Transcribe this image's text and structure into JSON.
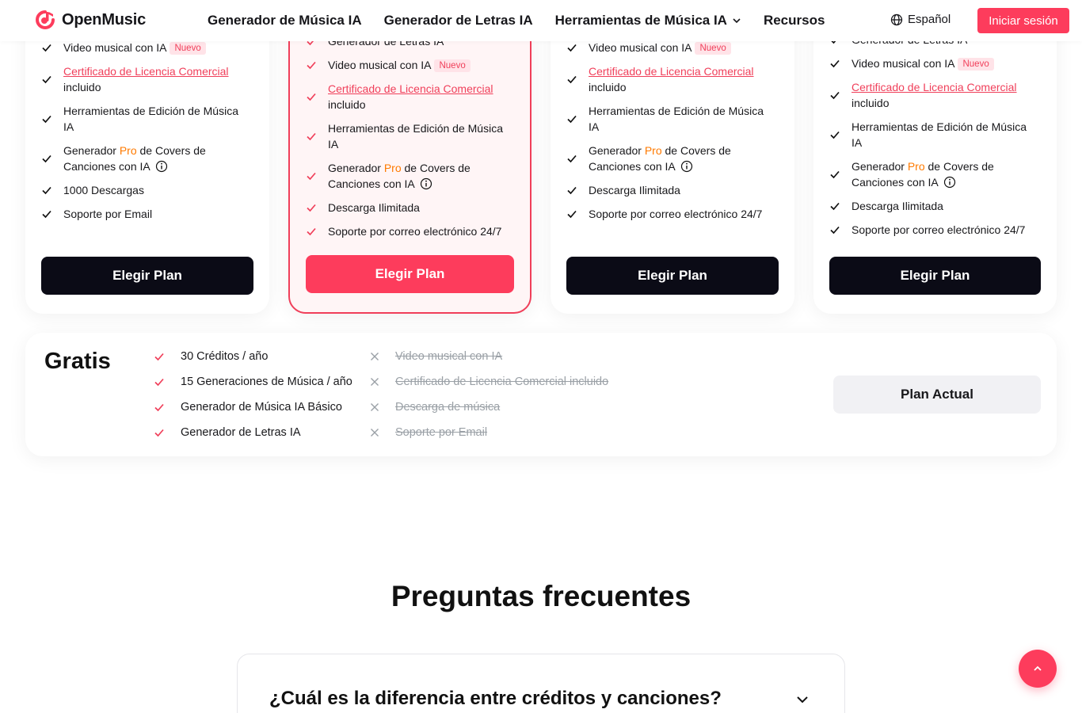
{
  "brand": {
    "name": "OpenMusic",
    "accent": "#fd3c5c",
    "dark": "#0b0b16",
    "pro_color": "#ff7a00"
  },
  "nav": {
    "items": [
      "Generador de Música IA",
      "Generador de Letras IA",
      "Herramientas de Música IA",
      "Recursos"
    ],
    "language": "Español",
    "login": "Iniciar sesión"
  },
  "plans": [
    {
      "features": {
        "video": "Video musical con IA",
        "license_link": "Certificado de Licencia Comercial",
        "license_suffix": "incluido",
        "editing": "Herramientas de Edición de Música IA",
        "covers_pre": "Generador",
        "covers_pro": "Pro",
        "covers_post": "de Covers de Canciones con IA",
        "downloads": "1000 Descargas",
        "support": "Soporte por Email"
      },
      "badge": "Nuevo",
      "button": "Elegir Plan"
    },
    {
      "features": {
        "lyrics": "Generador de Letras IA",
        "video": "Video musical con IA",
        "license_link": "Certificado de Licencia Comercial",
        "license_suffix": "incluido",
        "editing": "Herramientas de Edición de Música IA",
        "covers_pre": "Generador",
        "covers_pro": "Pro",
        "covers_post": "de Covers de Canciones con IA",
        "downloads": "Descarga Ilimitada",
        "support": "Soporte por correo electrónico 24/7"
      },
      "badge": "Nuevo",
      "button": "Elegir Plan"
    },
    {
      "features": {
        "video": "Video musical con IA",
        "license_link": "Certificado de Licencia Comercial",
        "license_suffix": "incluido",
        "editing": "Herramientas de Edición de Música IA",
        "covers_pre": "Generador",
        "covers_pro": "Pro",
        "covers_post": "de Covers de Canciones con IA",
        "downloads": "Descarga Ilimitada",
        "support": "Soporte por correo electrónico 24/7"
      },
      "badge": "Nuevo",
      "button": "Elegir Plan"
    },
    {
      "features": {
        "lyrics": "Generador de Letras IA",
        "video": "Video musical con IA",
        "license_link": "Certificado de Licencia Comercial",
        "license_suffix": "incluido",
        "editing": "Herramientas de Edición de Música IA",
        "covers_pre": "Generador",
        "covers_pro": "Pro",
        "covers_post": "de Covers de Canciones con IA",
        "downloads": "Descarga Ilimitada",
        "support": "Soporte por correo electrónico 24/7"
      },
      "badge": "Nuevo",
      "button": "Elegir Plan"
    }
  ],
  "free_plan": {
    "title": "Gratis",
    "included": [
      "30 Créditos / año",
      "15 Generaciones de Música / año",
      "Generador de Música IA Básico",
      "Generador de Letras IA"
    ],
    "excluded": [
      "Video musical con IA",
      "Certificado de Licencia Comercial incluido",
      "Descarga de música",
      "Soporte por Email"
    ],
    "button": "Plan Actual"
  },
  "faq": {
    "title": "Preguntas frecuentes",
    "items": [
      {
        "question": "¿Cuál es la diferencia entre créditos y canciones?"
      }
    ]
  },
  "icons": {
    "logo": "openmusic-logo-icon",
    "globe": "globe-icon",
    "check": "check-icon",
    "x": "x-icon",
    "info": "info-icon",
    "chevron": "chevron-down-icon",
    "to_top": "chevron-up-icon"
  }
}
